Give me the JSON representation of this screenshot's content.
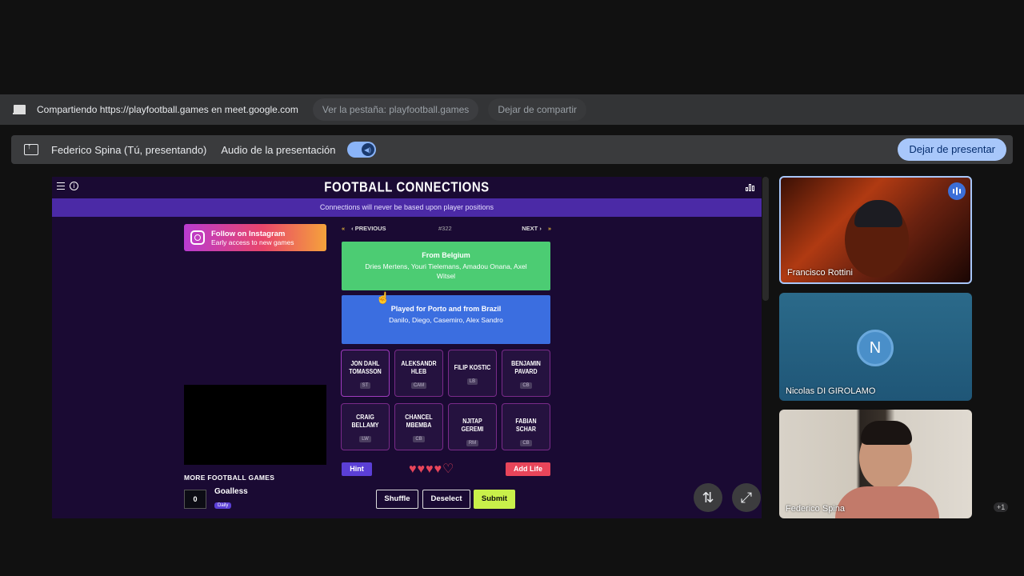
{
  "share_bar": {
    "sharing_text": "Compartiendo https://playfootball.games en meet.google.com",
    "view_tab": "Ver la pestaña: playfootball.games",
    "stop_sharing": "Dejar de compartir"
  },
  "present_bar": {
    "presenter": "Federico Spina (Tú, presentando)",
    "audio_label": "Audio de la presentación",
    "audio_enabled": true,
    "stop_presenting": "Dejar de presentar"
  },
  "game": {
    "title": "FOOTBALL CONNECTIONS",
    "notice": "Connections will never be based upon player positions",
    "instagram": {
      "line1": "Follow on Instagram",
      "line2": "Early access to new games"
    },
    "nav": {
      "previous": "PREVIOUS",
      "puzzle_number": "#322",
      "next": "NEXT"
    },
    "solved_groups": [
      {
        "title": "From Belgium",
        "members": "Dries Mertens, Youri Tielemans, Amadou Onana, Axel Witsel",
        "color": "#4ccc73"
      },
      {
        "title": "Played for Porto and from Brazil",
        "members": "Danilo, Diego, Casemiro, Alex Sandro",
        "color": "#3b6ee0"
      }
    ],
    "players": [
      {
        "name": "JON DAHL TOMASSON",
        "position": "ST"
      },
      {
        "name": "ALEKSANDR HLEB",
        "position": "CAM"
      },
      {
        "name": "FILIP KOSTIC",
        "position": "LB"
      },
      {
        "name": "BENJAMIN PAVARD",
        "position": "CB"
      },
      {
        "name": "CRAIG BELLAMY",
        "position": "LW"
      },
      {
        "name": "CHANCEL MBEMBA",
        "position": "CB"
      },
      {
        "name": "NJITAP GEREMI",
        "position": "RM"
      },
      {
        "name": "FABIAN SCHAR",
        "position": "CB"
      }
    ],
    "hint_label": "Hint",
    "lives": {
      "filled": 4,
      "total": 5
    },
    "add_life_label": "Add Life",
    "shuffle_label": "Shuffle",
    "deselect_label": "Deselect",
    "submit_label": "Submit",
    "more_games_title": "MORE FOOTBALL GAMES",
    "more_games": [
      {
        "icon_text": "0",
        "name": "Goalless",
        "badge": "Daily"
      }
    ]
  },
  "participants": [
    {
      "name": "Francisco Rottini",
      "speaking": true
    },
    {
      "name": "Nicolas DI GIROLAMO",
      "initial": "N"
    },
    {
      "name": "Federico Spina"
    }
  ],
  "overflow_count": "+1",
  "icons": {
    "laptop": "laptop-icon",
    "present": "present-to-all-icon",
    "swap": "swap-vertical-icon",
    "fullscreen": "fullscreen-icon"
  }
}
